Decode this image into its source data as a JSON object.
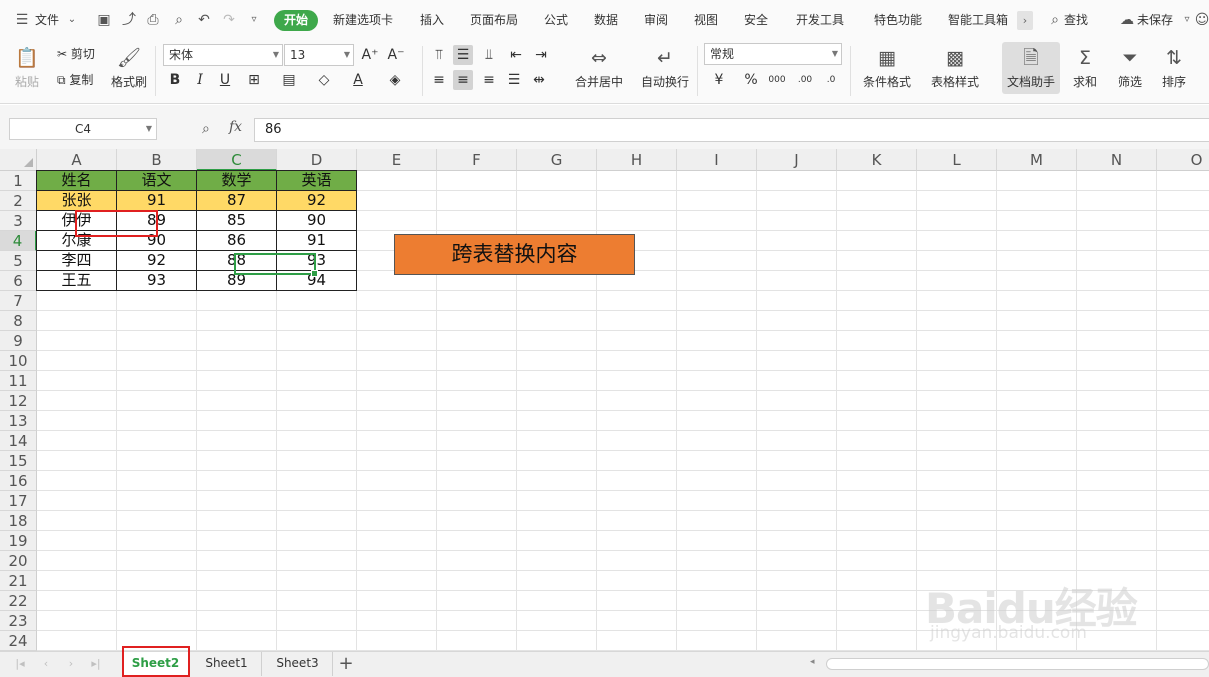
{
  "menubar": {
    "file_label": "文件",
    "tabs": [
      "开始",
      "新建选项卡",
      "插入",
      "页面布局",
      "公式",
      "数据",
      "审阅",
      "视图",
      "安全",
      "开发工具",
      "特色功能",
      "智能工具箱"
    ],
    "search_label": "查找",
    "save_status": "未保存"
  },
  "ribbon": {
    "paste": "粘贴",
    "cut": "剪切",
    "copy": "复制",
    "format_painter": "格式刷",
    "font_name": "宋体",
    "font_size": "13",
    "merge_center": "合并居中",
    "wrap_text": "自动换行",
    "number_format": "常规",
    "conditional_format": "条件格式",
    "table_style": "表格样式",
    "doc_assistant": "文档助手",
    "sum": "求和",
    "filter": "筛选",
    "sort": "排序"
  },
  "formula_bar": {
    "cell_ref": "C4",
    "fx_label": "fx",
    "value": "86"
  },
  "columns": [
    "A",
    "B",
    "C",
    "D",
    "E",
    "F",
    "G",
    "H",
    "I",
    "J",
    "K",
    "L",
    "M",
    "N",
    "O"
  ],
  "rows": [
    "1",
    "2",
    "3",
    "4",
    "5",
    "6",
    "7",
    "8",
    "9",
    "10",
    "11",
    "12",
    "13",
    "14",
    "15",
    "16",
    "17",
    "18",
    "19",
    "20",
    "21",
    "22",
    "23",
    "24"
  ],
  "table": {
    "headers": [
      "姓名",
      "语文",
      "数学",
      "英语"
    ],
    "rows": [
      [
        "张张",
        "91",
        "87",
        "92"
      ],
      [
        "伊伊",
        "89",
        "85",
        "90"
      ],
      [
        "尔康",
        "90",
        "86",
        "91"
      ],
      [
        "李四",
        "92",
        "88",
        "93"
      ],
      [
        "王五",
        "93",
        "89",
        "94"
      ]
    ]
  },
  "banner_text": "跨表替换内容",
  "sheet_tabs": [
    "Sheet2",
    "Sheet1",
    "Sheet3"
  ],
  "watermark": {
    "brand": "Baidu经验",
    "url": "jingyan.baidu.com"
  },
  "colors": {
    "accent": "#3ea84b",
    "header_fill": "#70ad47",
    "highlight_fill": "#ffd966",
    "banner_fill": "#ed7d31",
    "annotation_red": "#e02020"
  }
}
